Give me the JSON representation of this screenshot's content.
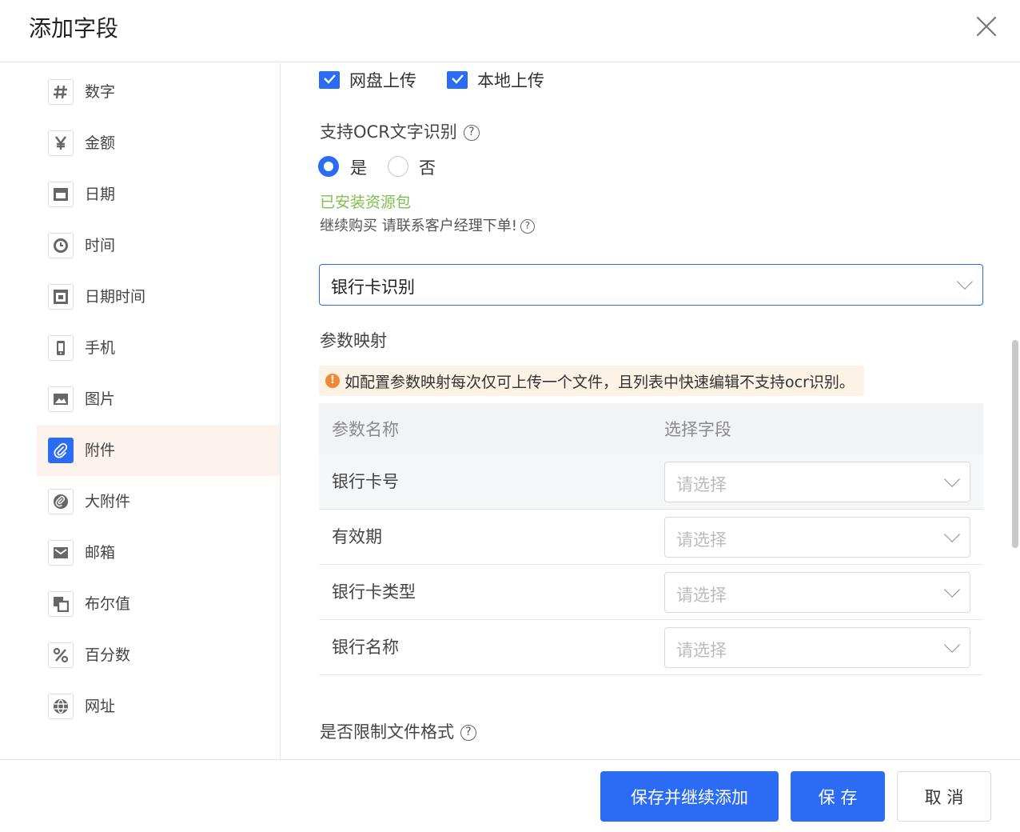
{
  "dialog": {
    "title": "添加字段",
    "close_icon": "close-icon"
  },
  "sidebar": {
    "items": [
      {
        "label": "数字",
        "icon": "hash-icon"
      },
      {
        "label": "金额",
        "icon": "yen-icon"
      },
      {
        "label": "日期",
        "icon": "calendar-icon"
      },
      {
        "label": "时间",
        "icon": "clock-icon"
      },
      {
        "label": "日期时间",
        "icon": "datetime-icon"
      },
      {
        "label": "手机",
        "icon": "phone-icon"
      },
      {
        "label": "图片",
        "icon": "image-icon"
      },
      {
        "label": "附件",
        "icon": "paperclip-icon",
        "active": true
      },
      {
        "label": "大附件",
        "icon": "large-attachment-icon"
      },
      {
        "label": "邮箱",
        "icon": "mail-icon"
      },
      {
        "label": "布尔值",
        "icon": "boolean-icon"
      },
      {
        "label": "百分数",
        "icon": "percent-icon"
      },
      {
        "label": "网址",
        "icon": "globe-icon"
      }
    ]
  },
  "upload": {
    "options": [
      "网盘上传",
      "本地上传"
    ]
  },
  "ocr": {
    "label": "支持OCR文字识别",
    "help": "?",
    "radio_yes": "是",
    "radio_no": "否",
    "status": "已安装资源包",
    "note": "继续购买 请联系客户经理下单!",
    "type_value": "银行卡识别"
  },
  "mapping": {
    "label": "参数映射",
    "warning": "如配置参数映射每次仅可上传一个文件，且列表中快速编辑不支持ocr识别。",
    "col_param": "参数名称",
    "col_field": "选择字段",
    "placeholder": "请选择",
    "rows": [
      {
        "name": "银行卡号"
      },
      {
        "name": "有效期"
      },
      {
        "name": "银行卡类型"
      },
      {
        "name": "银行名称"
      }
    ]
  },
  "format": {
    "label": "是否限制文件格式"
  },
  "footer": {
    "save_continue": "保存并继续添加",
    "save": "保 存",
    "cancel": "取 消"
  },
  "colors": {
    "primary": "#2c6cf5",
    "success_text": "#7cc04b",
    "warning": "#f0883a",
    "active_bg": "#fdf3ee"
  }
}
